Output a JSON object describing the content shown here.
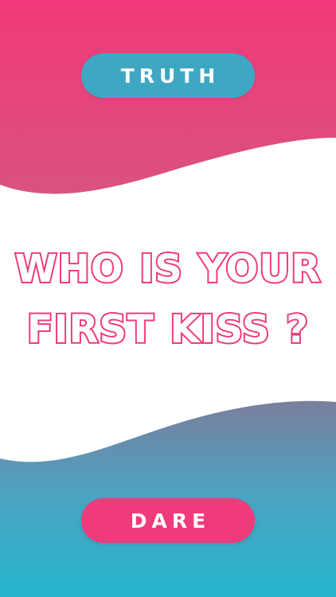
{
  "app": {
    "truth_label": "TRUTH",
    "dare_label": "DARE",
    "question": "WHO IS YOUR FIRST KISS ?"
  },
  "colors": {
    "pink": "#ef3b7b",
    "blue": "#3ea8c4",
    "pink_top": "#ef3b7b",
    "pink_wave": "#d8507f",
    "blue_wave": "#6f86a4",
    "blue_bottom": "#29b2cc",
    "text_outline": "#ef3b7b",
    "text_fill": "#ffffff"
  }
}
